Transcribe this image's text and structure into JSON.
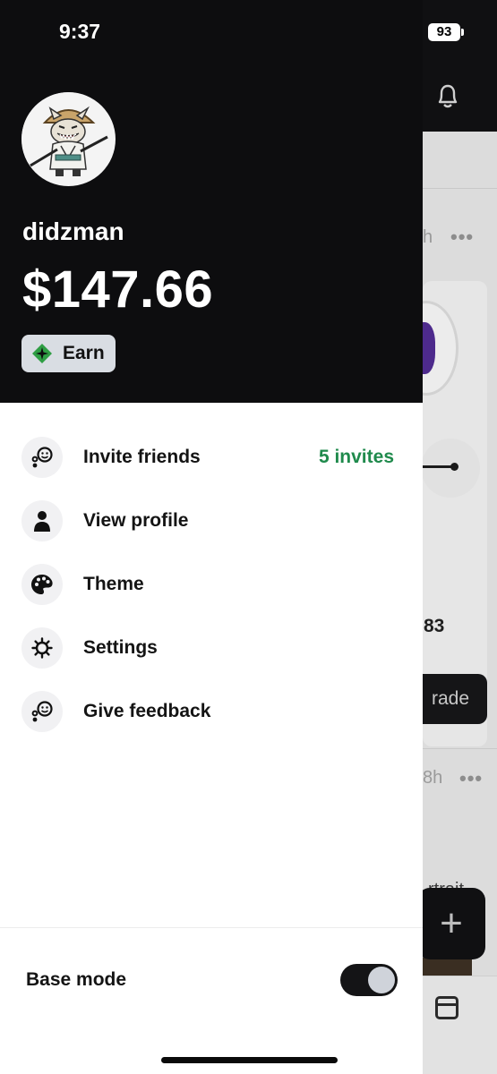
{
  "status_bar": {
    "time": "9:37",
    "battery": "93"
  },
  "profile": {
    "username": "didzman",
    "balance": "$147.66",
    "earn_label": "Earn"
  },
  "menu": {
    "items": [
      {
        "label": "Invite friends",
        "icon": "invite-icon",
        "trailing": "5 invites"
      },
      {
        "label": "View profile",
        "icon": "person-icon"
      },
      {
        "label": "Theme",
        "icon": "palette-icon"
      },
      {
        "label": "Settings",
        "icon": "gear-icon"
      },
      {
        "label": "Give feedback",
        "icon": "feedback-icon"
      }
    ]
  },
  "base_mode": {
    "label": "Base mode",
    "enabled": true
  },
  "background": {
    "partial_time_1": "h",
    "partial_time_2": "8h",
    "partial_number": "83",
    "partial_button": "rade",
    "partial_text": "rtrait",
    "fab_label": "+"
  },
  "colors": {
    "drawer_header": "#0d0d0f",
    "accent_green": "#1f8a4c",
    "earn_chip": "#d9dde3"
  }
}
